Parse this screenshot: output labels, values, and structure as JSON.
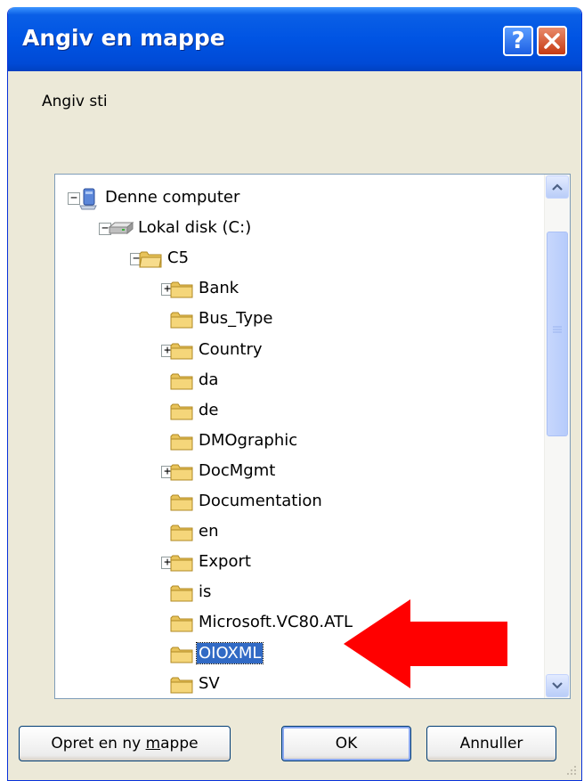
{
  "window": {
    "title": "Angiv en mappe"
  },
  "prompt": "Angiv sti",
  "tree": {
    "root": {
      "label": "Denne computer",
      "icon": "computer-icon",
      "expanded": true
    },
    "drive": {
      "label": "Lokal disk (C:)",
      "icon": "drive-icon",
      "expanded": true
    },
    "folder": {
      "label": "C5",
      "icon": "folder-open-icon",
      "expanded": true
    },
    "children": [
      {
        "label": "Bank",
        "expandable": true
      },
      {
        "label": "Bus_Type",
        "expandable": false
      },
      {
        "label": "Country",
        "expandable": true
      },
      {
        "label": "da",
        "expandable": false
      },
      {
        "label": "de",
        "expandable": false
      },
      {
        "label": "DMOgraphic",
        "expandable": false
      },
      {
        "label": "DocMgmt",
        "expandable": true
      },
      {
        "label": "Documentation",
        "expandable": false
      },
      {
        "label": "en",
        "expandable": false
      },
      {
        "label": "Export",
        "expandable": true
      },
      {
        "label": "is",
        "expandable": false
      },
      {
        "label": "Microsoft.VC80.ATL",
        "expandable": false
      },
      {
        "label": "OIOXML",
        "expandable": false,
        "selected": true
      },
      {
        "label": "SV",
        "expandable": false
      }
    ]
  },
  "buttons": {
    "new_folder": {
      "before": "Opret en ny ",
      "underline": "m",
      "after": "appe"
    },
    "ok": "OK",
    "cancel": "Annuller"
  },
  "annotation": {
    "type": "arrow",
    "color": "#ff0000",
    "points_to": "OIOXML"
  }
}
